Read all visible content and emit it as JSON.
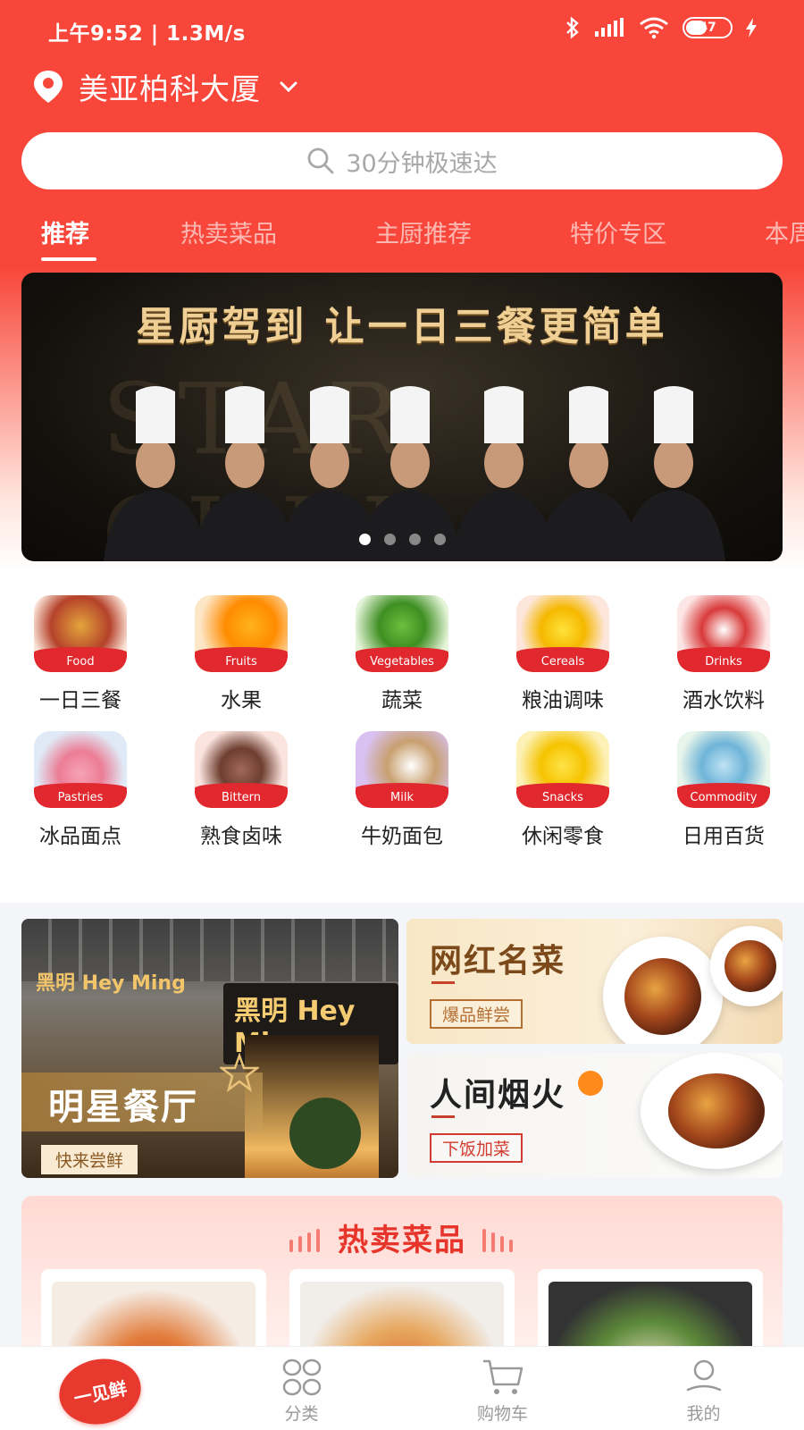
{
  "status_bar": {
    "time": "上午9:52 | 1.3M/s",
    "battery": "47"
  },
  "location": {
    "name": "美亚柏科大厦"
  },
  "search": {
    "placeholder": "30分钟极速达"
  },
  "tabs": [
    {
      "label": "推荐",
      "active": true
    },
    {
      "label": "热卖菜品",
      "active": false
    },
    {
      "label": "主厨推荐",
      "active": false
    },
    {
      "label": "特价专区",
      "active": false
    },
    {
      "label": "本周",
      "active": false
    }
  ],
  "banner": {
    "title": "星厨驾到  让一日三餐更简单",
    "background_text": "STAR CHEF",
    "page_count": 4,
    "current_page": 1
  },
  "categories": [
    {
      "label": "一日三餐",
      "tag": "Food"
    },
    {
      "label": "水果",
      "tag": "Fruits"
    },
    {
      "label": "蔬菜",
      "tag": "Vegetables"
    },
    {
      "label": "粮油调味",
      "tag": "Cereals"
    },
    {
      "label": "酒水饮料",
      "tag": "Drinks"
    },
    {
      "label": "冰品面点",
      "tag": "Pastries"
    },
    {
      "label": "熟食卤味",
      "tag": "Bittern"
    },
    {
      "label": "牛奶面包",
      "tag": "Milk"
    },
    {
      "label": "休闲零食",
      "tag": "Snacks"
    },
    {
      "label": "日用百货",
      "tag": "Commodity"
    }
  ],
  "promos": {
    "left": {
      "title": "明星餐厅",
      "tag": "快来尝鲜",
      "sign_small": "黑明 Hey Ming",
      "sign_large": "黑明 Hey Ming"
    },
    "right_top": {
      "title": "网红名菜",
      "tag": "爆品鲜尝"
    },
    "right_bottom": {
      "title": "人间烟火",
      "tag": "下饭加菜"
    }
  },
  "hot_section": {
    "title": "热卖菜品"
  },
  "tabbar": {
    "home_logo": "一见鲜",
    "items": [
      {
        "label": "分类"
      },
      {
        "label": "购物车"
      },
      {
        "label": "我的"
      }
    ]
  },
  "colors": {
    "brand_red": "#f8473a",
    "accent_red": "#e0282e"
  }
}
